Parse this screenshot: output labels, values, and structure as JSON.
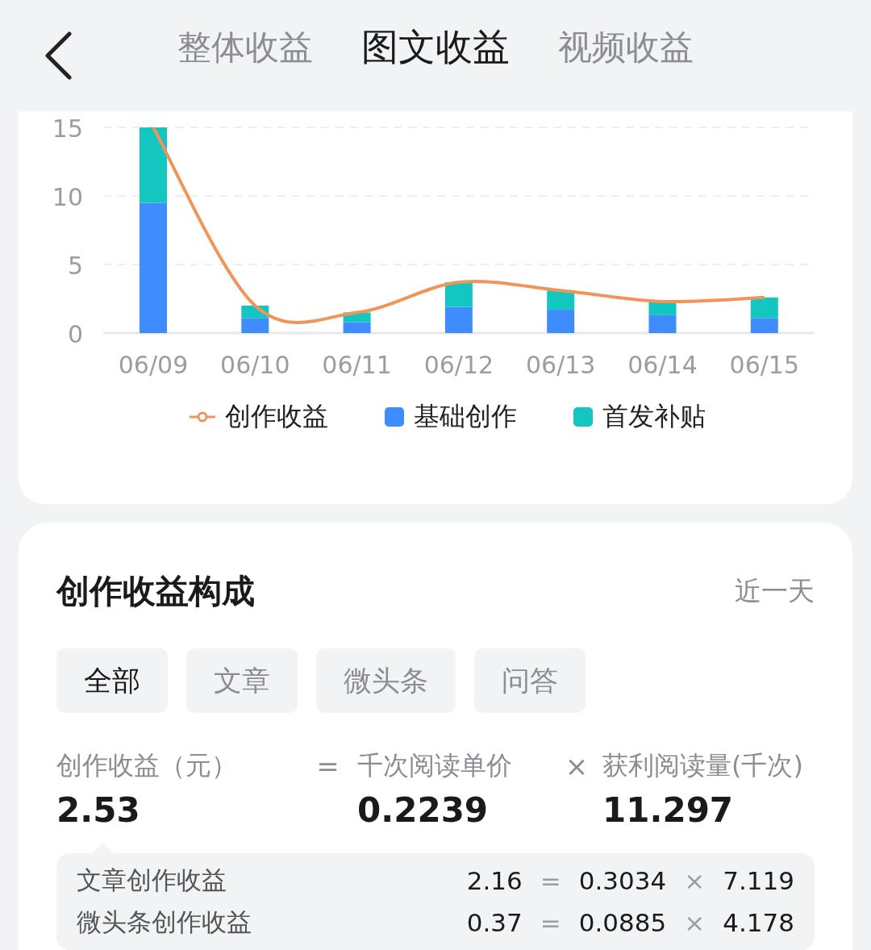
{
  "header": {
    "tabs": [
      {
        "label": "整体收益",
        "selected": false
      },
      {
        "label": "图文收益",
        "selected": true
      },
      {
        "label": "视频收益",
        "selected": false
      }
    ]
  },
  "chart_card": {
    "chart_data": {
      "type": "bar",
      "stacked": true,
      "categories": [
        "06/09",
        "06/10",
        "06/11",
        "06/12",
        "06/13",
        "06/14",
        "06/15"
      ],
      "ylim": [
        0,
        15
      ],
      "yticks": [
        0,
        5,
        10,
        15
      ],
      "series": [
        {
          "name": "基础创作",
          "color": "#3f8cff",
          "values": [
            9.5,
            1.1,
            0.8,
            1.9,
            1.7,
            1.3,
            1.1
          ]
        },
        {
          "name": "首发补贴",
          "color": "#13c6c0",
          "values": [
            5.5,
            0.9,
            0.7,
            1.8,
            1.4,
            1.0,
            1.5
          ]
        },
        {
          "name": "创作收益",
          "color": "#f0955a",
          "type": "line",
          "values": [
            15,
            2.0,
            1.5,
            3.7,
            3.1,
            2.3,
            2.6
          ]
        }
      ]
    }
  },
  "composition": {
    "title": "创作收益构成",
    "period": "近一天",
    "filters": [
      {
        "label": "全部",
        "selected": true
      },
      {
        "label": "文章",
        "selected": false
      },
      {
        "label": "微头条",
        "selected": false
      },
      {
        "label": "问答",
        "selected": false
      }
    ],
    "formula": {
      "items": [
        {
          "label": "创作收益（元）",
          "value": "2.53"
        },
        {
          "label": "千次阅读单价",
          "value": "0.2239"
        },
        {
          "label": "获利阅读量(千次)",
          "value": "11.297"
        }
      ],
      "operators": [
        "=",
        "×"
      ]
    },
    "breakdown": [
      {
        "label": "文章创作收益",
        "total": "2.16",
        "equals": "=",
        "price": "0.3034",
        "times": "×",
        "reads": "7.119"
      },
      {
        "label": "微头条创作收益",
        "total": "0.37",
        "equals": "=",
        "price": "0.0885",
        "times": "×",
        "reads": "4.178"
      }
    ]
  }
}
